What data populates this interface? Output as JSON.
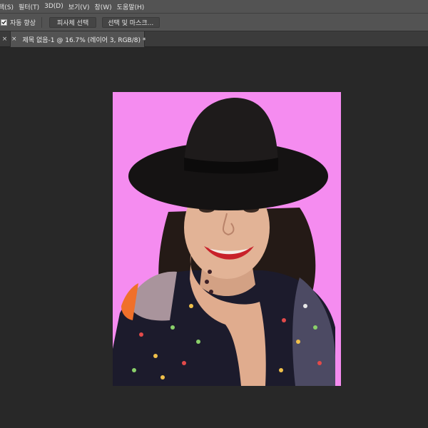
{
  "menu": {
    "items": [
      "택(S)",
      "필터(T)",
      "3D(D)",
      "보기(V)",
      "창(W)",
      "도움말(H)"
    ]
  },
  "options": {
    "auto_enhance_label": "자동 향상",
    "auto_enhance_checked": true,
    "select_subject_label": "피사체 선택",
    "select_mask_label": "선택 및 마스크..."
  },
  "tabs": {
    "document_title": "제목 없음-1 @ 16.7% (레이어 3, RGB/8) *",
    "close_glyph": "×"
  },
  "canvas": {
    "background_color": "#f58cf0",
    "content": "photo-woman-with-hat"
  },
  "colors": {
    "menubar": "#535353",
    "tabbar": "#3b3b3b",
    "workspace": "#282828"
  }
}
